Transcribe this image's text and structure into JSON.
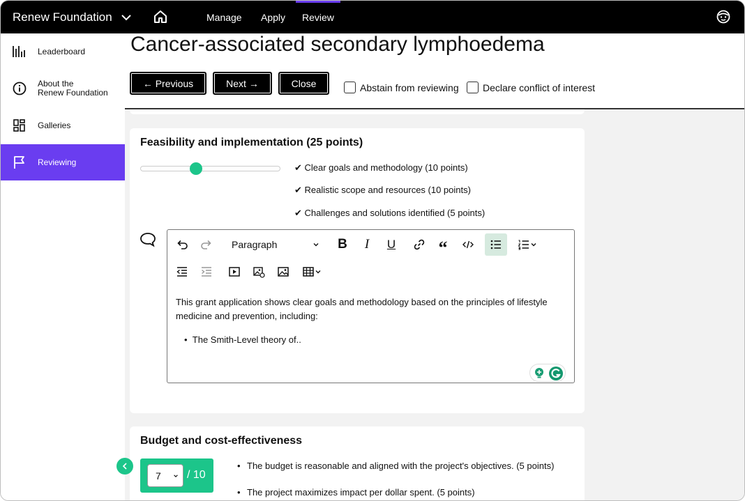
{
  "topbar": {
    "org_name": "Renew Foundation",
    "nav": [
      "Manage",
      "Apply",
      "Review"
    ],
    "active_nav": "Review"
  },
  "sidebar": {
    "items": [
      {
        "label": "Leaderboard",
        "icon": "bar-chart-icon"
      },
      {
        "label": "About the\nRenew Foundation",
        "icon": "info-icon"
      },
      {
        "label": "Galleries",
        "icon": "dashboard-icon"
      },
      {
        "label": "Reviewing",
        "icon": "flag-icon"
      }
    ],
    "active": "Reviewing"
  },
  "header": {
    "title": "Cancer-associated secondary lymphoedema",
    "previous_label": "← Previous",
    "next_label": "Next →",
    "close_label": "Close",
    "abstain_label": "Abstain from reviewing",
    "conflict_label": "Declare conflict of interest"
  },
  "feasibility": {
    "title": "Feasibility and implementation (25 points)",
    "slider_value": 0.4,
    "criteria": [
      "✔ Clear goals and methodology (10 points)",
      "✔ Realistic scope and resources (10 points)",
      "✔ Challenges and solutions identified (5 points)"
    ],
    "editor": {
      "block_format": "Paragraph",
      "text": "This grant application shows clear goals and methodology based on the principles of lifestyle medicine and prevention, including:",
      "bullet": "The Smith-Level theory of.."
    }
  },
  "budget": {
    "title": "Budget and cost-effectiveness",
    "score": "7",
    "total": "/ 10",
    "criteria": [
      "The budget is reasonable and aligned with the project's objectives. (5 points)",
      "The project maximizes impact per dollar spent. (5 points)"
    ]
  },
  "colors": {
    "accent": "#6a3df0",
    "green": "#1cc58a",
    "topbar": "#000000"
  }
}
